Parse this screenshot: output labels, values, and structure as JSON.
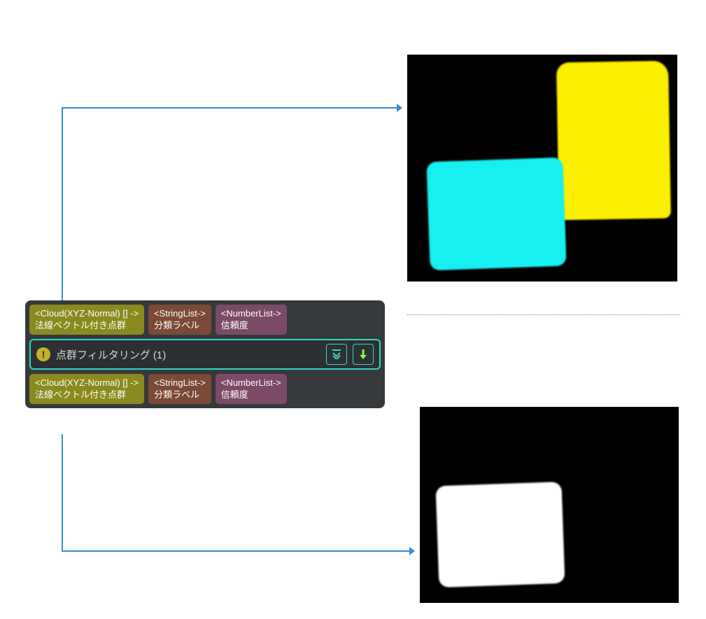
{
  "node": {
    "title": "点群フィルタリング (1)",
    "warn_glyph": "!",
    "inputs": [
      {
        "type": "<Cloud(XYZ-Normal) [] ->",
        "label": "法線ベクトル付き点群",
        "cls": "port-cloud"
      },
      {
        "type": "<StringList->",
        "label": "分類ラベル",
        "cls": "port-string"
      },
      {
        "type": "<NumberList->",
        "label": "信頼度",
        "cls": "port-number"
      }
    ],
    "outputs": [
      {
        "type": "<Cloud(XYZ-Normal) [] ->",
        "label": "法線ベクトル付き点群",
        "cls": "port-cloud"
      },
      {
        "type": "<StringList->",
        "label": "分類ラベル",
        "cls": "port-string"
      },
      {
        "type": "<NumberList->",
        "label": "信頼度",
        "cls": "port-number"
      }
    ]
  },
  "wire_color": "#3a8dd0",
  "thumbs": {
    "top": {
      "blobs": [
        "yellow",
        "cyan"
      ]
    },
    "bottom": {
      "blobs": [
        "white"
      ]
    }
  }
}
